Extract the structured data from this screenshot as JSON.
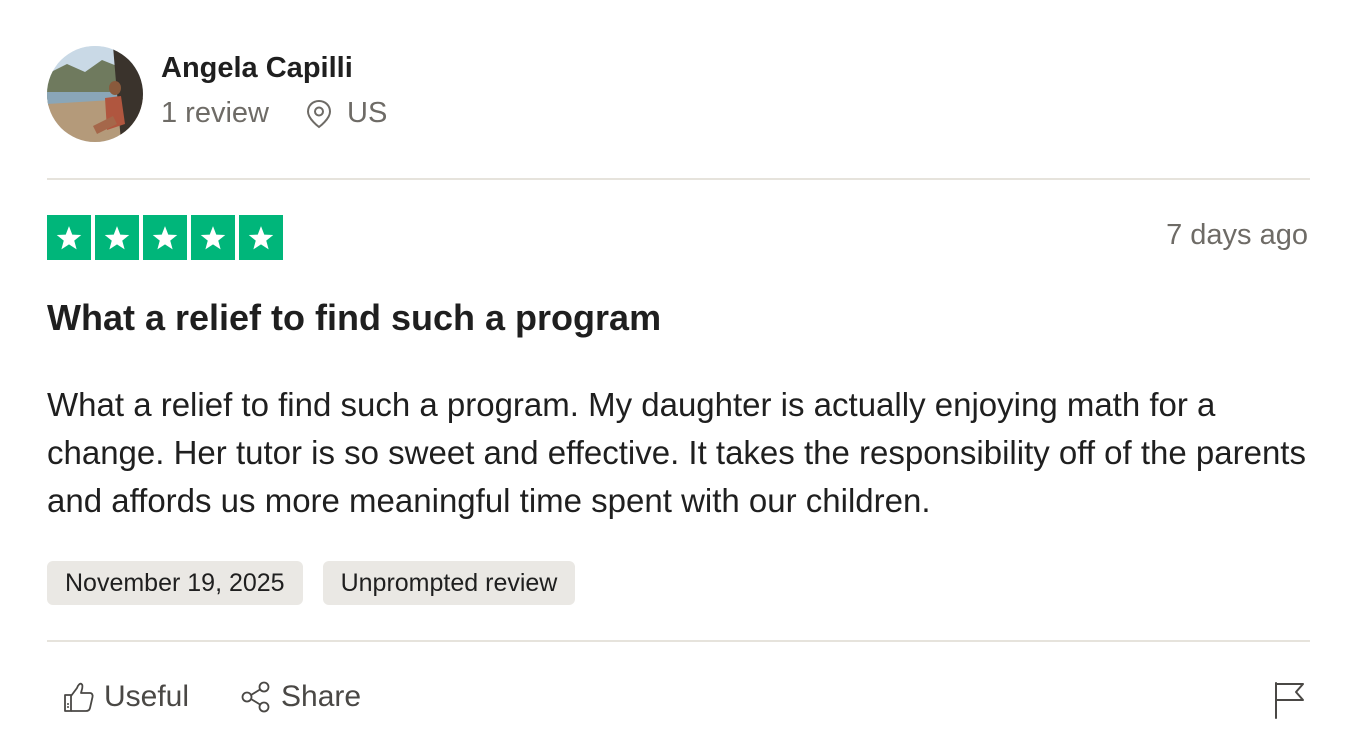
{
  "reviewer": {
    "name": "Angela Capilli",
    "review_count": "1 review",
    "country": "US"
  },
  "review": {
    "rating": 5,
    "max_rating": 5,
    "relative_date": "7 days ago",
    "title": "What a relief to find such a program",
    "body": "What a relief to find such a program. My daughter is actually enjoying math for a change. Her tutor is so sweet and effective. It takes the responsibility off of the parents and affords us more meaningful time spent with our children.",
    "tags": [
      "November 19, 2025",
      "Unprompted review"
    ]
  },
  "actions": {
    "useful_label": "Useful",
    "share_label": "Share"
  },
  "icons": {
    "location": "map-pin-icon",
    "star": "star-icon",
    "useful": "thumbs-up-icon",
    "share": "share-icon",
    "report": "flag-icon"
  },
  "colors": {
    "star_green": "#00b67a",
    "muted_text": "#6e6b66",
    "tag_bg": "#eae8e4",
    "divider": "#e6e3dc"
  }
}
